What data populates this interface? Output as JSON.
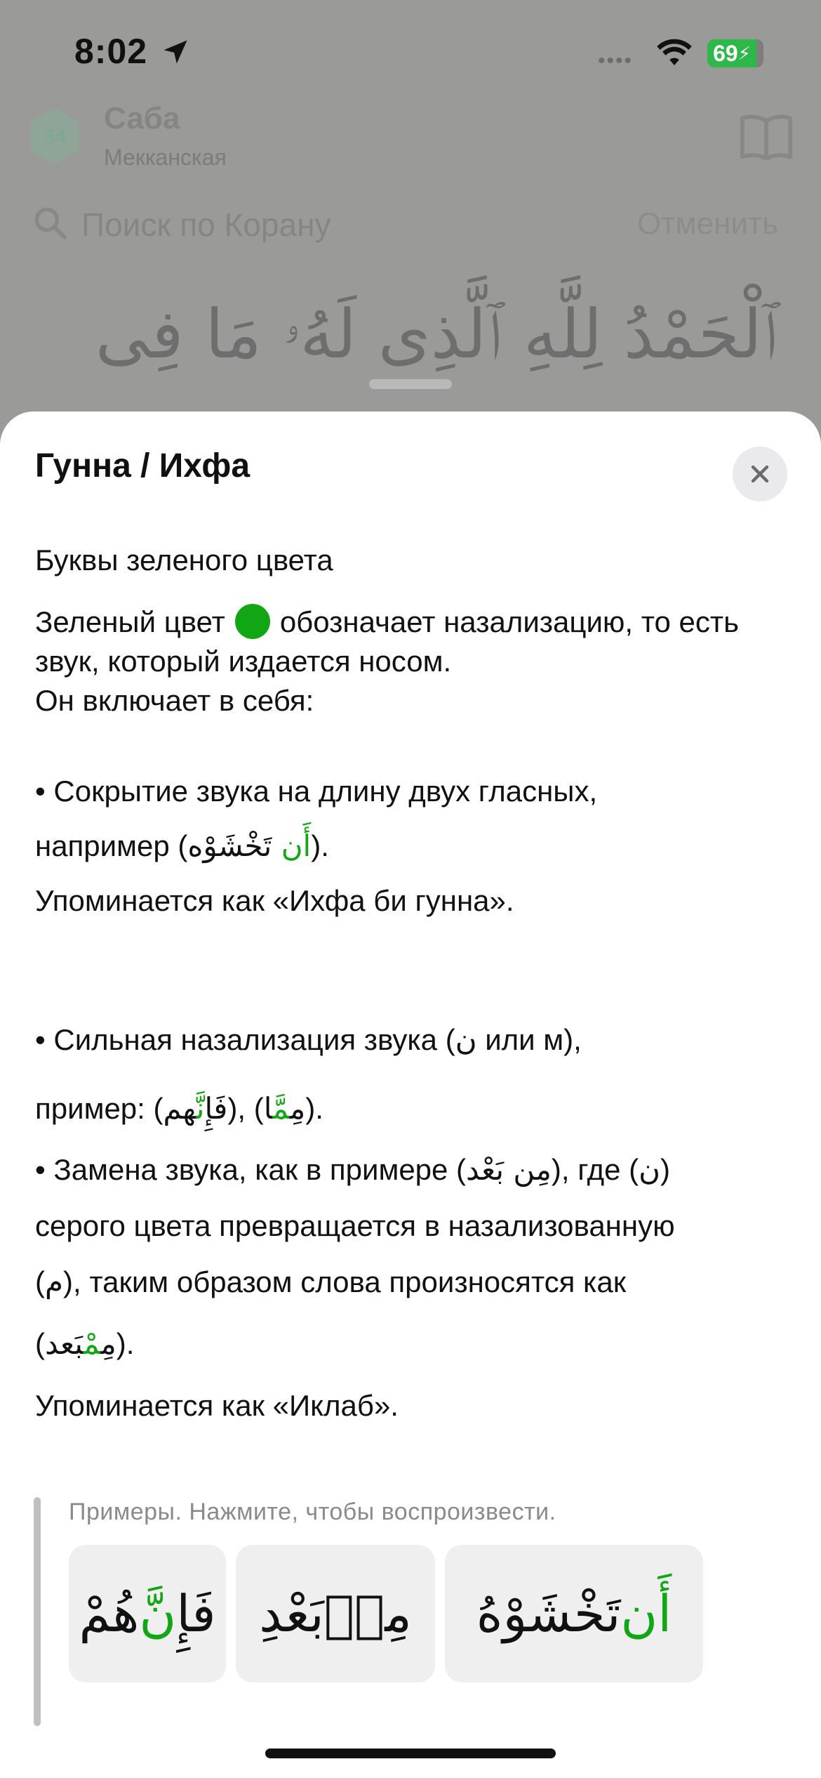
{
  "status_bar": {
    "time": "8:02",
    "battery": "69"
  },
  "surah": {
    "number": "34",
    "name": "Саба",
    "place": "Мекканская"
  },
  "search": {
    "placeholder": "Поиск по Корану",
    "cancel": "Отменить"
  },
  "background_ayah": "ٱلْحَمْدُ لِلَّهِ ٱلَّذِى لَهُۥ مَا فِى",
  "sheet": {
    "title": "Гунна / Ихфа",
    "subtitle": "Буквы зеленого цвета",
    "p1_before_dot": "Зеленый цвет",
    "p1_after_dot": "обозначает назализацию, то есть звук, который издается носом.",
    "p1_line3": "Он включает в себя:",
    "b1_line1": "• Сокрытие звука на длину двух гласных,",
    "b1_prefix": "например (",
    "b1_ar_green": "أَن",
    "b1_ar_rest": " تَخْشَوْه",
    "b1_suffix": ").",
    "b1_line3": "Упоминается как «Ихфа би гунна».",
    "b2_prefix": "• Сильная назализация звука (",
    "b2_ar": "ن",
    "b2_suffix": " или м),",
    "b2_line2_prefix": "пример: (",
    "b2_ex1_a": "فَإِ",
    "b2_ex1_green": "نَّ",
    "b2_ex1_b": "هم",
    "b2_mid": "), (",
    "b2_ex2_a": "مِ",
    "b2_ex2_green": "مَّ",
    "b2_ex2_b": "ا",
    "b2_line2_suffix": ").",
    "b3_prefix": "• Замена звука, как в примере (",
    "b3_ar1": "مِن بَعْد",
    "b3_mid": "), где (",
    "b3_ar2": "ن",
    "b3_suffix": ")",
    "b3_line2": "серого цвета превращается в назализованную",
    "b3_line3_prefix": "(",
    "b3_ar3": "م",
    "b3_line3_suffix": "), таким образом слова произносятся как",
    "b3_line4_prefix": "(",
    "b3_ar4_a": "مِ",
    "b3_ar4_green": "مْ",
    "b3_ar4_b": "بَعد",
    "b3_line4_suffix": ").",
    "b3_line5": "Упоминается как «Иклаб».",
    "examples_caption": "Примеры. Нажмите, чтобы воспроизвести.",
    "examples": [
      {
        "green": "أَن",
        "rest": " تَخْشَوْهُ"
      },
      {
        "a": "مِنۢ",
        "b": " بَعْدِ"
      },
      {
        "a": "فَإِ",
        "green": "نَّ",
        "b": "هُمْ"
      }
    ]
  },
  "colors": {
    "accent_green": "#11a614",
    "battery_green": "#2fb84a",
    "sheet_bg": "#ffffff",
    "dim_overlay": "#9a9a98"
  }
}
